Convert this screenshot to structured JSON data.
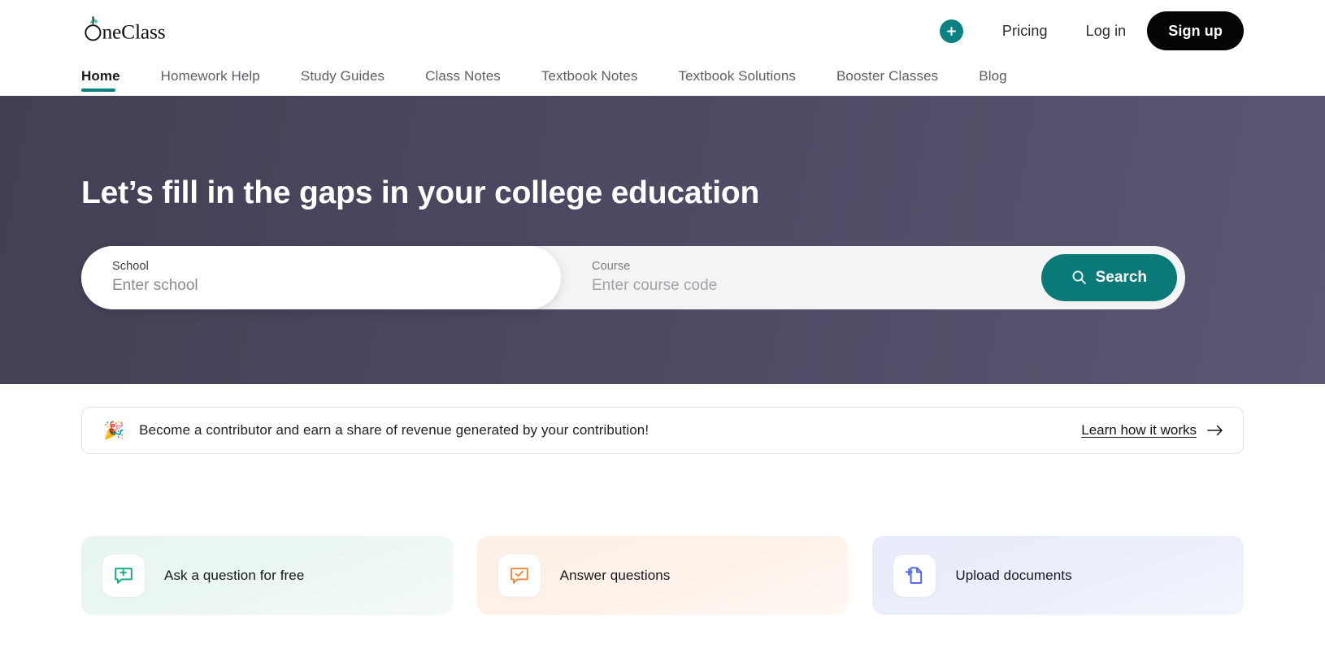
{
  "header": {
    "logo_text": "OneClass",
    "logo_icon": "apple-logo-icon",
    "add_button_icon": "plus-icon",
    "pricing_label": "Pricing",
    "login_label": "Log in",
    "signup_label": "Sign up",
    "tabs": [
      {
        "label": "Home",
        "active": true
      },
      {
        "label": "Homework Help",
        "active": false
      },
      {
        "label": "Study Guides",
        "active": false
      },
      {
        "label": "Class Notes",
        "active": false
      },
      {
        "label": "Textbook Notes",
        "active": false
      },
      {
        "label": "Textbook Solutions",
        "active": false
      },
      {
        "label": "Booster Classes",
        "active": false
      },
      {
        "label": "Blog",
        "active": false
      }
    ]
  },
  "hero": {
    "title": "Let’s fill in the gaps in your college education",
    "school_field": {
      "label": "School",
      "placeholder": "Enter school",
      "value": ""
    },
    "course_field": {
      "label": "Course",
      "placeholder": "Enter course code",
      "value": ""
    },
    "search_button": {
      "label": "Search",
      "icon": "search-icon"
    }
  },
  "banner": {
    "emoji": "🎉",
    "text": "Become a contributor and earn a share of revenue generated by your contribution!",
    "link_label": "Learn how it works",
    "link_icon": "arrow-right-icon"
  },
  "cards": [
    {
      "label": "Ask a question for free",
      "icon": "chat-plus-icon",
      "theme": "green"
    },
    {
      "label": "Answer questions",
      "icon": "chat-check-icon",
      "theme": "orange"
    },
    {
      "label": "Upload documents",
      "icon": "document-plus-icon",
      "theme": "blue"
    }
  ],
  "colors": {
    "accent_teal": "#0c8181",
    "search_button_teal": "#0a7a78",
    "signup_black": "#050505",
    "hero_gradient_start": "#434054",
    "hero_gradient_end": "#5b5773",
    "card_green_icon": "#0fa97f",
    "card_orange_icon": "#f08437",
    "card_blue_icon": "#4a63e7"
  }
}
